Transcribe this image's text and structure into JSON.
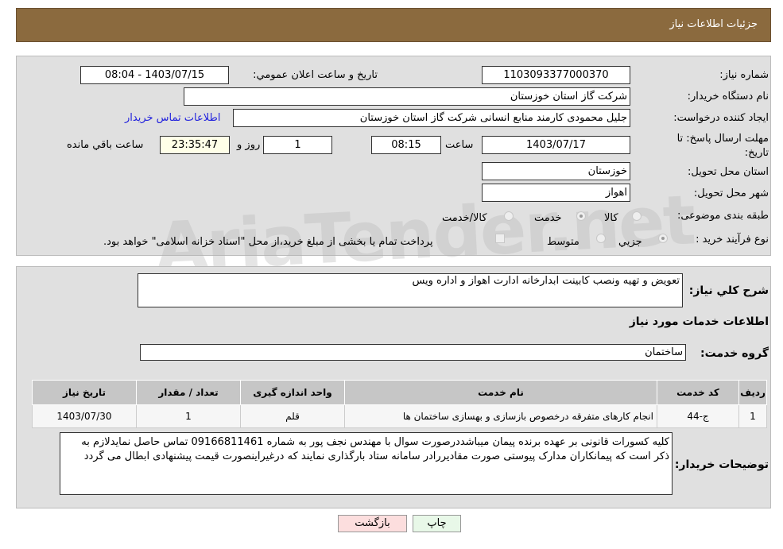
{
  "header": {
    "title": "جزئیات اطلاعات نیاز"
  },
  "watermark": "AriaTender.net",
  "form": {
    "need_number_label": "شماره نیاز:",
    "need_number": "1103093377000370",
    "announce_label": "تاریخ و ساعت اعلان عمومي:",
    "announce_value": "1403/07/15 - 08:04",
    "buyer_org_label": "نام دستگاه خریدار:",
    "buyer_org": "شرکت گاز استان خوزستان",
    "creator_label": "ایجاد کننده درخواست:",
    "creator": "جلیل محمودی کارمند منابع انسانی شرکت گاز استان خوزستان",
    "contact_link": "اطلاعات تماس خریدار",
    "deadline_label": "مهلت ارسال پاسخ: تا تاریخ:",
    "deadline_date": "1403/07/17",
    "time_label": "ساعت",
    "deadline_time": "08:15",
    "days": "1",
    "days_label": "روز و",
    "remaining": "23:35:47",
    "remaining_label": "ساعت باقي مانده",
    "province_label": "استان محل تحویل:",
    "province": "خوزستان",
    "city_label": "شهر محل تحویل:",
    "city": "اهواز",
    "category_label": "طبقه بندی موضوعی:",
    "category_options": [
      "کالا",
      "خدمت",
      "کالا/خدمت"
    ],
    "category_selected": "خدمت",
    "process_label": "نوع فرآیند خرید :",
    "process_options": [
      "جزيي",
      "متوسط"
    ],
    "process_selected": "جزيي",
    "payment_note": "پرداخت تمام یا بخشی از مبلغ خرید،از محل \"اسناد خزانه اسلامی\" خواهد بود."
  },
  "details": {
    "summary_label": "شرح کلي نیاز:",
    "summary": "تعویض و تهیه ونصب کابینت ابدارخانه ادارت اهواز و اداره ویس",
    "services_title": "اطلاعات خدمات مورد نیاز",
    "group_label": "گروه خدمت:",
    "group": "ساختمان",
    "table": {
      "headers": [
        "ردیف",
        "کد خدمت",
        "نام خدمت",
        "واحد اندازه گیری",
        "تعداد / مقدار",
        "تاریخ نیاز"
      ],
      "rows": [
        [
          "1",
          "ج-44",
          "انجام کارهای متفرقه درخصوص بازسازی و بهسازی ساختمان ها",
          "قلم",
          "1",
          "1403/07/30"
        ]
      ]
    },
    "buyer_notes_label": "توضیحات خریدار:",
    "buyer_notes": "کلیه کسورات قانونی بر عهده برنده پیمان میباشددرصورت سوال با مهندس نجف پور به شماره 09166811461 تماس حاصل نمایدلازم به ذکر است که پیمانکاران مدارک پیوستی صورت مقادیررادر سامانه ستاد بارگذاری نمایند که درغیراینصورت قیمت پیشنهادی ابطال می گردد"
  },
  "buttons": {
    "print": "چاپ",
    "back": "بازگشت"
  }
}
